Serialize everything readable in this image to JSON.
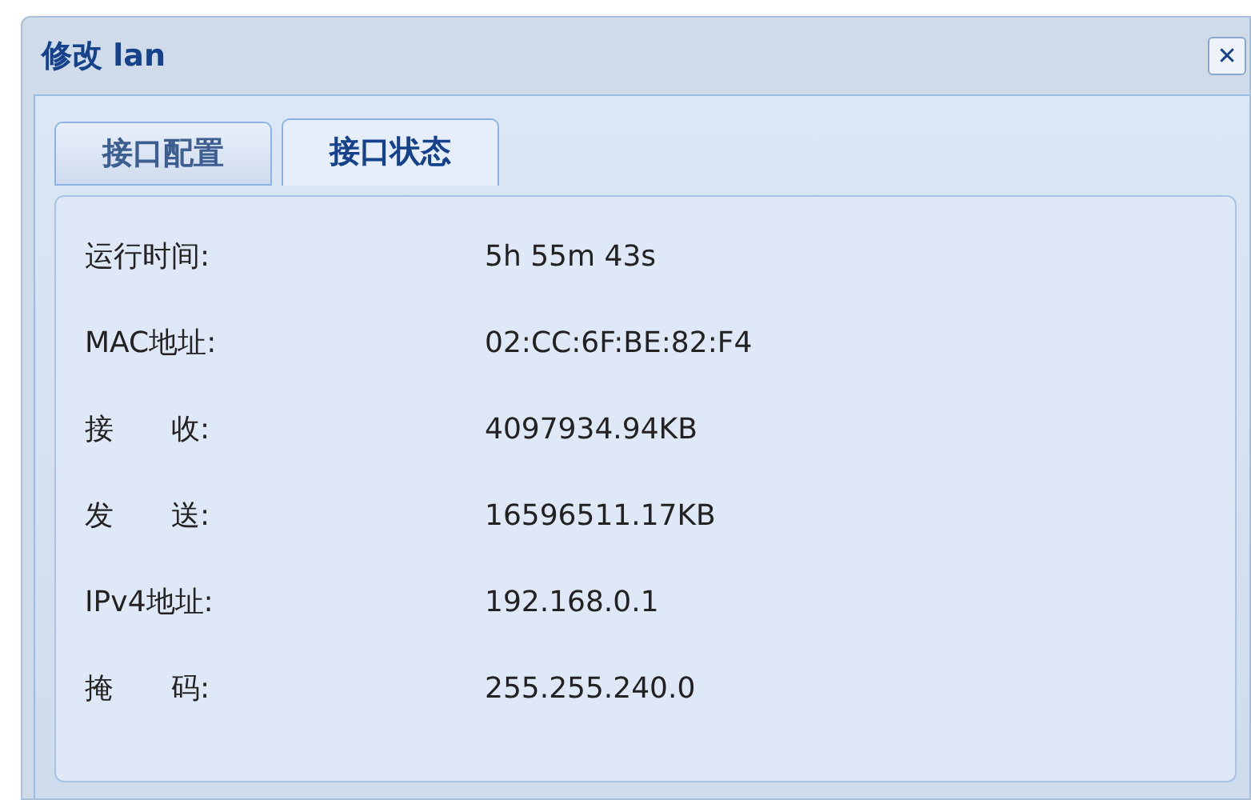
{
  "window": {
    "title": "修改 lan",
    "close": "✕"
  },
  "tabs": [
    {
      "label": "接口配置",
      "selected": false
    },
    {
      "label": "接口状态",
      "selected": true
    }
  ],
  "rows": [
    {
      "label": "运行时间:",
      "value": "5h 55m 43s"
    },
    {
      "label": "MAC地址:",
      "value": "02:CC:6F:BE:82:F4"
    },
    {
      "label": "接　　收:",
      "value": "4097934.94KB"
    },
    {
      "label": "发　　送:",
      "value": "16596511.17KB"
    },
    {
      "label": "IPv4地址:",
      "value": "192.168.0.1"
    },
    {
      "label": "掩　　码:",
      "value": "255.255.240.0"
    }
  ]
}
